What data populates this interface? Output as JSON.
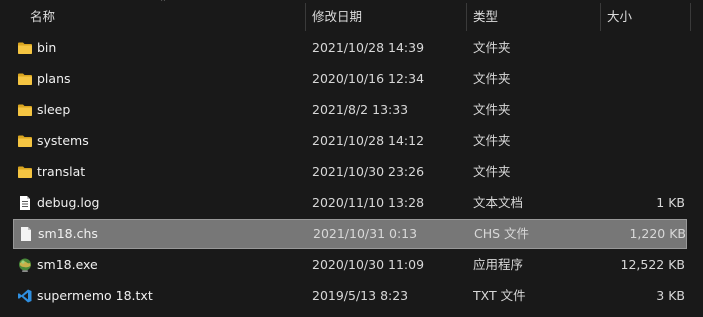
{
  "columns": {
    "name": "名称",
    "date": "修改日期",
    "type": "类型",
    "size": "大小"
  },
  "files": [
    {
      "name": "bin",
      "date": "2021/10/28 14:39",
      "type": "文件夹",
      "size": "",
      "icon": "folder-icon"
    },
    {
      "name": "plans",
      "date": "2020/10/16 12:34",
      "type": "文件夹",
      "size": "",
      "icon": "folder-icon"
    },
    {
      "name": "sleep",
      "date": "2021/8/2 13:33",
      "type": "文件夹",
      "size": "",
      "icon": "folder-icon"
    },
    {
      "name": "systems",
      "date": "2021/10/28 14:12",
      "type": "文件夹",
      "size": "",
      "icon": "folder-icon"
    },
    {
      "name": "translat",
      "date": "2021/10/30 23:26",
      "type": "文件夹",
      "size": "",
      "icon": "folder-icon"
    },
    {
      "name": "debug.log",
      "date": "2020/11/10 13:28",
      "type": "文本文档",
      "size": "1 KB",
      "icon": "text-file-icon"
    },
    {
      "name": "sm18.chs",
      "date": "2021/10/31 0:13",
      "type": "CHS 文件",
      "size": "1,220 KB",
      "icon": "file-icon",
      "selected": true
    },
    {
      "name": "sm18.exe",
      "date": "2020/10/30 11:09",
      "type": "应用程序",
      "size": "12,522 KB",
      "icon": "app-globe-icon"
    },
    {
      "name": "supermemo 18.txt",
      "date": "2019/5/13 8:23",
      "type": "TXT 文件",
      "size": "3 KB",
      "icon": "vscode-file-icon"
    }
  ]
}
